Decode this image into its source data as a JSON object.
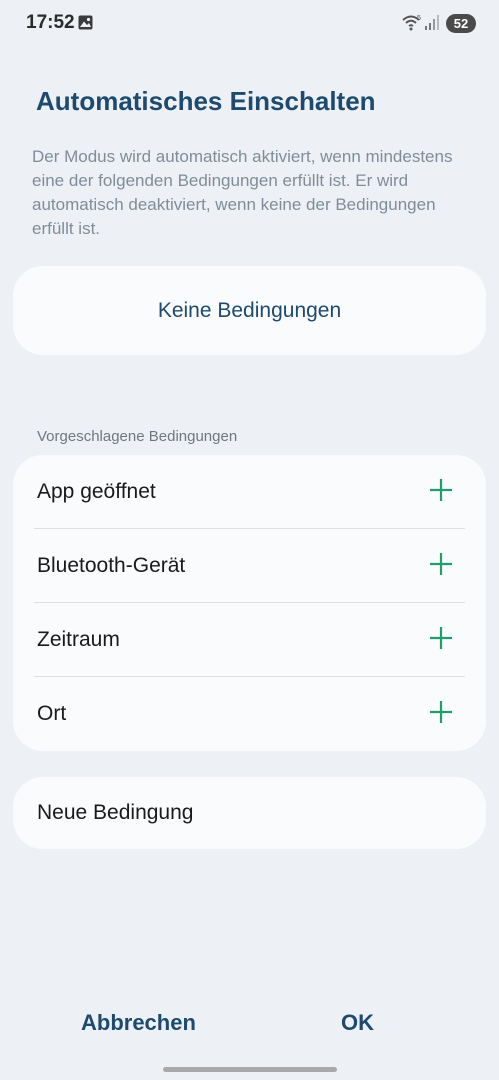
{
  "status_bar": {
    "time": "17:52",
    "battery": "52",
    "icons": [
      "gallery-icon",
      "wifi-icon",
      "signal-icon"
    ]
  },
  "title": "Automatisches Einschalten",
  "description": "Der Modus wird automatisch aktiviert, wenn mindestens eine der folgenden Bedingungen erfüllt ist. Er wird automatisch deaktiviert, wenn keine der Bedingungen erfüllt ist.",
  "no_conditions_label": "Keine Bedingungen",
  "suggested": {
    "header": "Vorgeschlagene Bedingungen",
    "items": [
      {
        "label": "App geöffnet",
        "icon": "plus-icon"
      },
      {
        "label": "Bluetooth-Gerät",
        "icon": "plus-icon"
      },
      {
        "label": "Zeitraum",
        "icon": "plus-icon"
      },
      {
        "label": "Ort",
        "icon": "plus-icon"
      }
    ]
  },
  "new_condition_label": "Neue Bedingung",
  "buttons": {
    "cancel": "Abbrechen",
    "ok": "OK"
  },
  "colors": {
    "accent": "#1d4a6e",
    "plus": "#1f9d6b",
    "background": "#edf0f4",
    "card": "#fafbfc"
  }
}
